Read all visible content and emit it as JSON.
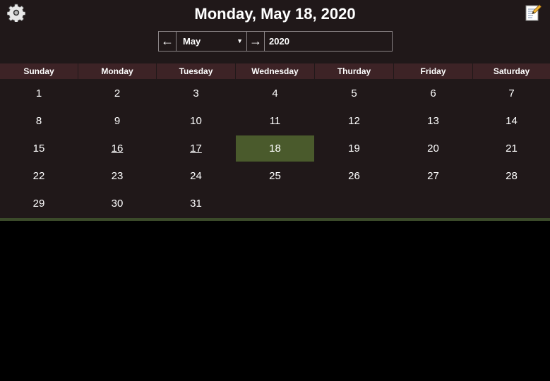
{
  "header": {
    "title": "Monday, May 18, 2020",
    "settings_icon": "gear-icon",
    "notes_icon": "memo-icon"
  },
  "nav": {
    "prev_label": "←",
    "next_label": "→",
    "month_value": "May",
    "year_value": "2020"
  },
  "weekdays": [
    "Sunday",
    "Monday",
    "Tuesday",
    "Wednesday",
    "Thurday",
    "Friday",
    "Saturday"
  ],
  "weeks": [
    [
      "1",
      "2",
      "3",
      "4",
      "5",
      "6",
      "7"
    ],
    [
      "8",
      "9",
      "10",
      "11",
      "12",
      "13",
      "14"
    ],
    [
      "15",
      "16",
      "17",
      "18",
      "19",
      "20",
      "21"
    ],
    [
      "22",
      "23",
      "24",
      "25",
      "26",
      "27",
      "28"
    ],
    [
      "29",
      "30",
      "31",
      "",
      "",
      "",
      ""
    ]
  ],
  "selected_day": "18",
  "days_with_notes": [
    "16",
    "17"
  ],
  "colors": {
    "background": "#201819",
    "weekday_header": "#3d2326",
    "selected": "#4a5a2c",
    "bottom_bar": "#3b4a2a"
  }
}
